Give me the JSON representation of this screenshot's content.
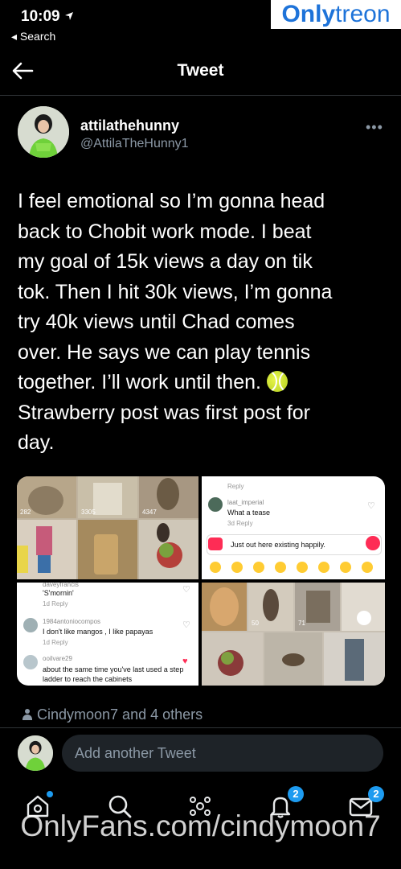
{
  "status_bar": {
    "time": "10:09",
    "back_app": "◂ Search"
  },
  "watermark_top": {
    "part1": "Only",
    "part2": "treon"
  },
  "header": {
    "title": "Tweet"
  },
  "author": {
    "display_name": "attilathehunny",
    "handle": "@AttilaTheHunny1"
  },
  "tweet": {
    "text_before_emoji": "I feel emotional so I’m gonna head\nback to Chobit work mode. I beat\nmy goal of 15k views a day on tik\ntok. Then I hit 30k views, I’m gonna\ntry 40k views until Chad comes\nover. He says we can play tennis\ntogether. I’ll work until then. ",
    "emoji_icon": "tennis-ball-icon",
    "text_after_emoji": "\nStrawberry post was first post for\nday."
  },
  "media": {
    "tile1": {
      "counts": [
        "282",
        "3305",
        "4347"
      ]
    },
    "tile2": {
      "reply_top": "Reply",
      "comment_user": "laat_imperial",
      "comment_text": "What a tease",
      "comment_meta": "3d  Reply",
      "compose_text": "Just out here existing happily."
    },
    "tile3": {
      "comments": [
        {
          "user": "daveyfrancis",
          "text": "'S'mornin'",
          "meta": "1d  Reply"
        },
        {
          "user": "1984antoniocompos",
          "text": "I don't like mangos , I like papayas",
          "meta": "1d  Reply"
        },
        {
          "user": "ooilvare29",
          "text": "about the same time you've last used a step ladder to reach the cabinets",
          "meta": ""
        }
      ]
    },
    "tile4": {
      "counts": [
        "50",
        "71"
      ]
    }
  },
  "likes": {
    "text": "Cindymoon7 and 4 others"
  },
  "reply": {
    "placeholder": "Add another Tweet"
  },
  "tabbar": {
    "icons": [
      "home-icon",
      "search-icon",
      "spaces-icon",
      "notifications-icon",
      "messages-icon"
    ],
    "notifications_badge": "2",
    "messages_badge": "2"
  },
  "watermark_bottom": {
    "text": "OnlyFans.com/cindymoon7"
  },
  "colors": {
    "accent": "#1d9bf0",
    "background": "#000000",
    "secondary_text": "#8b98a5"
  }
}
